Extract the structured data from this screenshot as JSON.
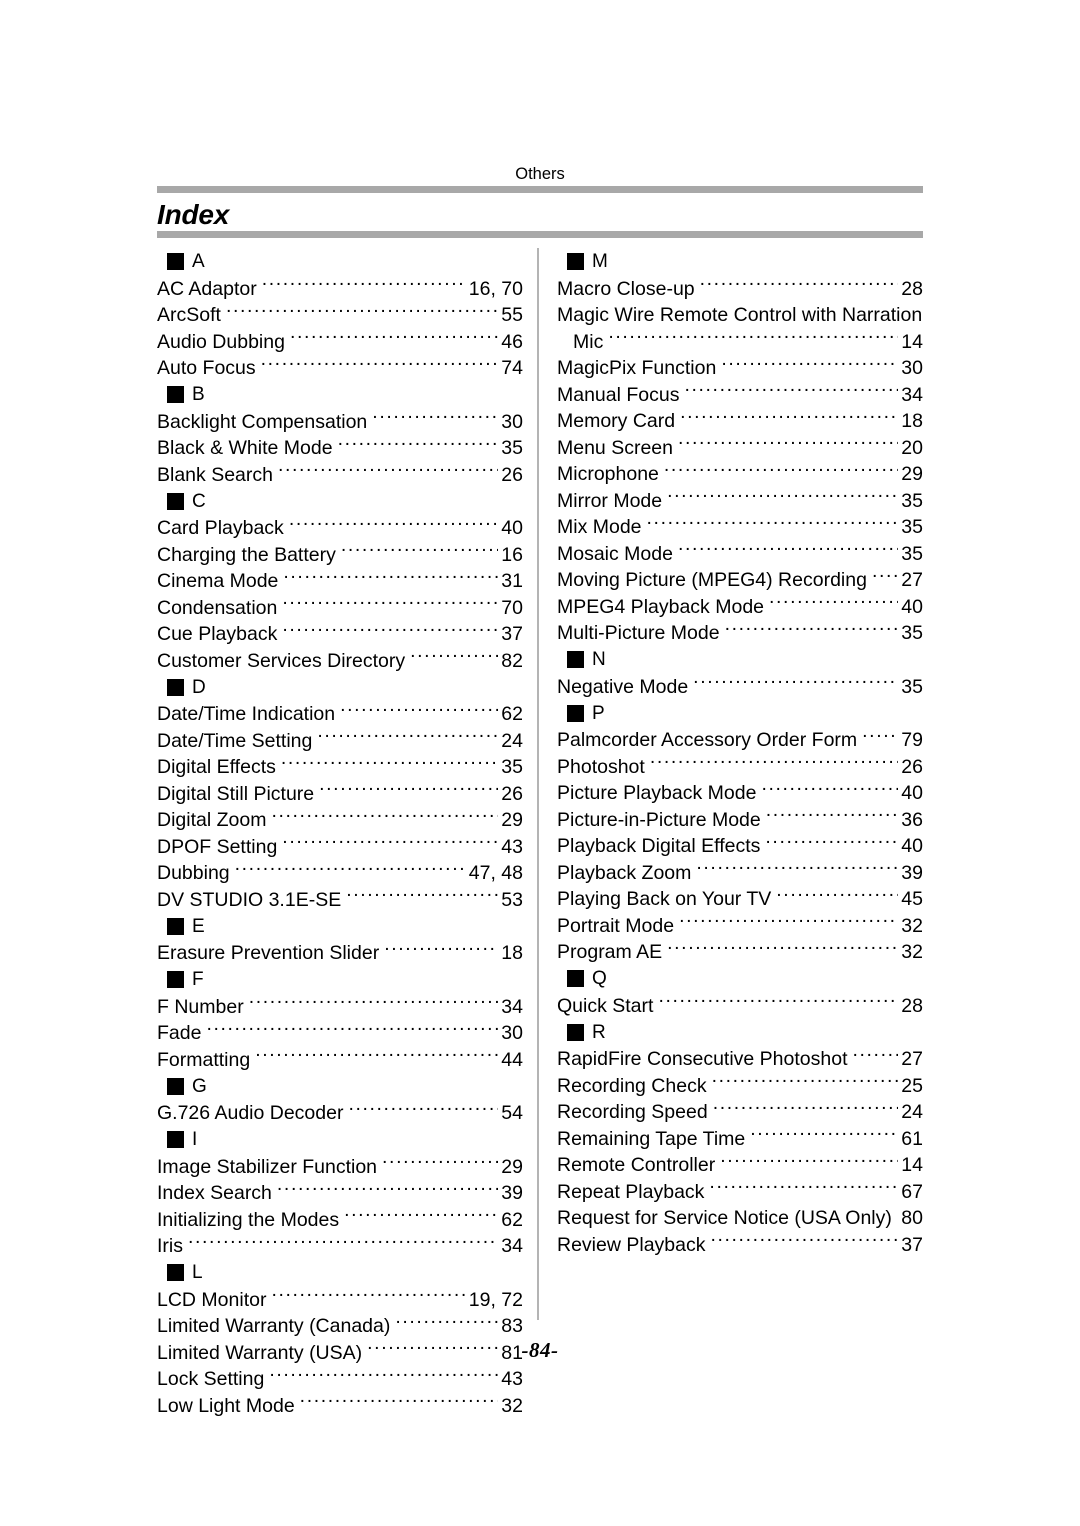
{
  "header": {
    "running_head": "Others",
    "title": "Index"
  },
  "footer": {
    "page_number": "-84-"
  },
  "colors": {
    "rule": "#a8a8a8",
    "divider": "#b4b4b4",
    "marker": "#000000",
    "text": "#000000"
  },
  "columns": {
    "left": [
      {
        "type": "section",
        "letter": "A"
      },
      {
        "type": "entry",
        "label": "AC Adaptor",
        "page": "16, 70"
      },
      {
        "type": "entry",
        "label": "ArcSoft",
        "page": "55"
      },
      {
        "type": "entry",
        "label": "Audio Dubbing",
        "page": "46"
      },
      {
        "type": "entry",
        "label": "Auto Focus",
        "page": "74"
      },
      {
        "type": "section",
        "letter": "B"
      },
      {
        "type": "entry",
        "label": "Backlight Compensation",
        "page": "30"
      },
      {
        "type": "entry",
        "label": "Black & White Mode",
        "page": "35"
      },
      {
        "type": "entry",
        "label": "Blank Search",
        "page": "26"
      },
      {
        "type": "section",
        "letter": "C"
      },
      {
        "type": "entry",
        "label": "Card Playback",
        "page": "40"
      },
      {
        "type": "entry",
        "label": "Charging the Battery",
        "page": "16"
      },
      {
        "type": "entry",
        "label": "Cinema Mode",
        "page": "31"
      },
      {
        "type": "entry",
        "label": "Condensation",
        "page": "70"
      },
      {
        "type": "entry",
        "label": "Cue Playback",
        "page": "37"
      },
      {
        "type": "entry",
        "label": "Customer Services Directory",
        "page": "82"
      },
      {
        "type": "section",
        "letter": "D"
      },
      {
        "type": "entry",
        "label": "Date/Time Indication",
        "page": "62"
      },
      {
        "type": "entry",
        "label": "Date/Time Setting",
        "page": "24"
      },
      {
        "type": "entry",
        "label": "Digital Effects",
        "page": "35"
      },
      {
        "type": "entry",
        "label": "Digital Still Picture",
        "page": "26"
      },
      {
        "type": "entry",
        "label": "Digital Zoom",
        "page": "29"
      },
      {
        "type": "entry",
        "label": "DPOF Setting",
        "page": "43"
      },
      {
        "type": "entry",
        "label": "Dubbing",
        "page": "47, 48"
      },
      {
        "type": "entry",
        "label": "DV STUDIO 3.1E-SE",
        "page": "53"
      },
      {
        "type": "section",
        "letter": "E"
      },
      {
        "type": "entry",
        "label": "Erasure Prevention Slider",
        "page": "18"
      },
      {
        "type": "section",
        "letter": "F"
      },
      {
        "type": "entry",
        "label": "F Number",
        "page": "34"
      },
      {
        "type": "entry",
        "label": "Fade",
        "page": "30"
      },
      {
        "type": "entry",
        "label": "Formatting",
        "page": "44"
      },
      {
        "type": "section",
        "letter": "G"
      },
      {
        "type": "entry",
        "label": "G.726 Audio Decoder",
        "page": "54"
      },
      {
        "type": "section",
        "letter": "I"
      },
      {
        "type": "entry",
        "label": "Image Stabilizer Function",
        "page": "29"
      },
      {
        "type": "entry",
        "label": "Index Search",
        "page": "39"
      },
      {
        "type": "entry",
        "label": "Initializing the Modes",
        "page": "62"
      },
      {
        "type": "entry",
        "label": "Iris",
        "page": "34"
      },
      {
        "type": "section",
        "letter": "L"
      },
      {
        "type": "entry",
        "label": "LCD Monitor",
        "page": "19, 72"
      },
      {
        "type": "entry",
        "label": "Limited Warranty (Canada)",
        "page": "83"
      },
      {
        "type": "entry",
        "label": "Limited Warranty (USA)",
        "page": "81"
      },
      {
        "type": "entry",
        "label": "Lock Setting",
        "page": "43"
      },
      {
        "type": "entry",
        "label": "Low Light Mode",
        "page": "32"
      }
    ],
    "right": [
      {
        "type": "section",
        "letter": "M"
      },
      {
        "type": "entry",
        "label": "Macro Close-up",
        "page": "28"
      },
      {
        "type": "textline",
        "label": "Magic Wire Remote Control with Narration"
      },
      {
        "type": "entry",
        "label": "Mic",
        "page": "14",
        "continuation": true
      },
      {
        "type": "entry",
        "label": "MagicPix Function",
        "page": "30"
      },
      {
        "type": "entry",
        "label": "Manual Focus",
        "page": "34"
      },
      {
        "type": "entry",
        "label": "Memory Card",
        "page": "18"
      },
      {
        "type": "entry",
        "label": "Menu Screen",
        "page": "20"
      },
      {
        "type": "entry",
        "label": "Microphone",
        "page": "29"
      },
      {
        "type": "entry",
        "label": "Mirror Mode",
        "page": "35"
      },
      {
        "type": "entry",
        "label": "Mix Mode",
        "page": "35"
      },
      {
        "type": "entry",
        "label": "Mosaic Mode",
        "page": "35"
      },
      {
        "type": "entry",
        "label": "Moving Picture (MPEG4) Recording",
        "page": "27"
      },
      {
        "type": "entry",
        "label": "MPEG4 Playback Mode",
        "page": "40"
      },
      {
        "type": "entry",
        "label": "Multi-Picture Mode",
        "page": "35"
      },
      {
        "type": "section",
        "letter": "N"
      },
      {
        "type": "entry",
        "label": "Negative Mode",
        "page": "35"
      },
      {
        "type": "section",
        "letter": "P"
      },
      {
        "type": "entry",
        "label": "Palmcorder Accessory Order Form",
        "page": "79"
      },
      {
        "type": "entry",
        "label": "Photoshot",
        "page": "26"
      },
      {
        "type": "entry",
        "label": "Picture Playback Mode",
        "page": "40"
      },
      {
        "type": "entry",
        "label": "Picture-in-Picture Mode",
        "page": "36"
      },
      {
        "type": "entry",
        "label": "Playback Digital Effects",
        "page": "40"
      },
      {
        "type": "entry",
        "label": "Playback Zoom",
        "page": "39"
      },
      {
        "type": "entry",
        "label": "Playing Back on Your TV",
        "page": "45"
      },
      {
        "type": "entry",
        "label": "Portrait Mode",
        "page": "32"
      },
      {
        "type": "entry",
        "label": "Program AE",
        "page": "32"
      },
      {
        "type": "section",
        "letter": "Q"
      },
      {
        "type": "entry",
        "label": "Quick Start",
        "page": "28"
      },
      {
        "type": "section",
        "letter": "R"
      },
      {
        "type": "entry",
        "label": "RapidFire Consecutive Photoshot",
        "page": "27"
      },
      {
        "type": "entry",
        "label": "Recording Check",
        "page": "25"
      },
      {
        "type": "entry",
        "label": "Recording Speed",
        "page": "24"
      },
      {
        "type": "entry",
        "label": "Remaining Tape Time",
        "page": "61"
      },
      {
        "type": "entry",
        "label": "Remote Controller",
        "page": "14"
      },
      {
        "type": "entry",
        "label": "Repeat Playback",
        "page": "67"
      },
      {
        "type": "entry",
        "label": "Request for Service Notice (USA Only)",
        "page": "80"
      },
      {
        "type": "entry",
        "label": "Review Playback",
        "page": "37"
      }
    ]
  }
}
